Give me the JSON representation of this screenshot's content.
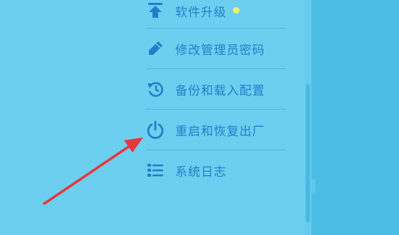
{
  "menu": {
    "items": [
      {
        "label": "软件升级",
        "icon": "upload-icon",
        "has_badge": true
      },
      {
        "label": "修改管理员密码",
        "icon": "pencil-icon"
      },
      {
        "label": "备份和载入配置",
        "icon": "history-icon"
      },
      {
        "label": "重启和恢复出厂",
        "icon": "power-icon"
      },
      {
        "label": "系统日志",
        "icon": "list-icon"
      }
    ]
  },
  "colors": {
    "background": "#6dcff0",
    "text": "#1f7fc9",
    "badge": "#f2f06a",
    "annotation_arrow": "#e5383b"
  }
}
